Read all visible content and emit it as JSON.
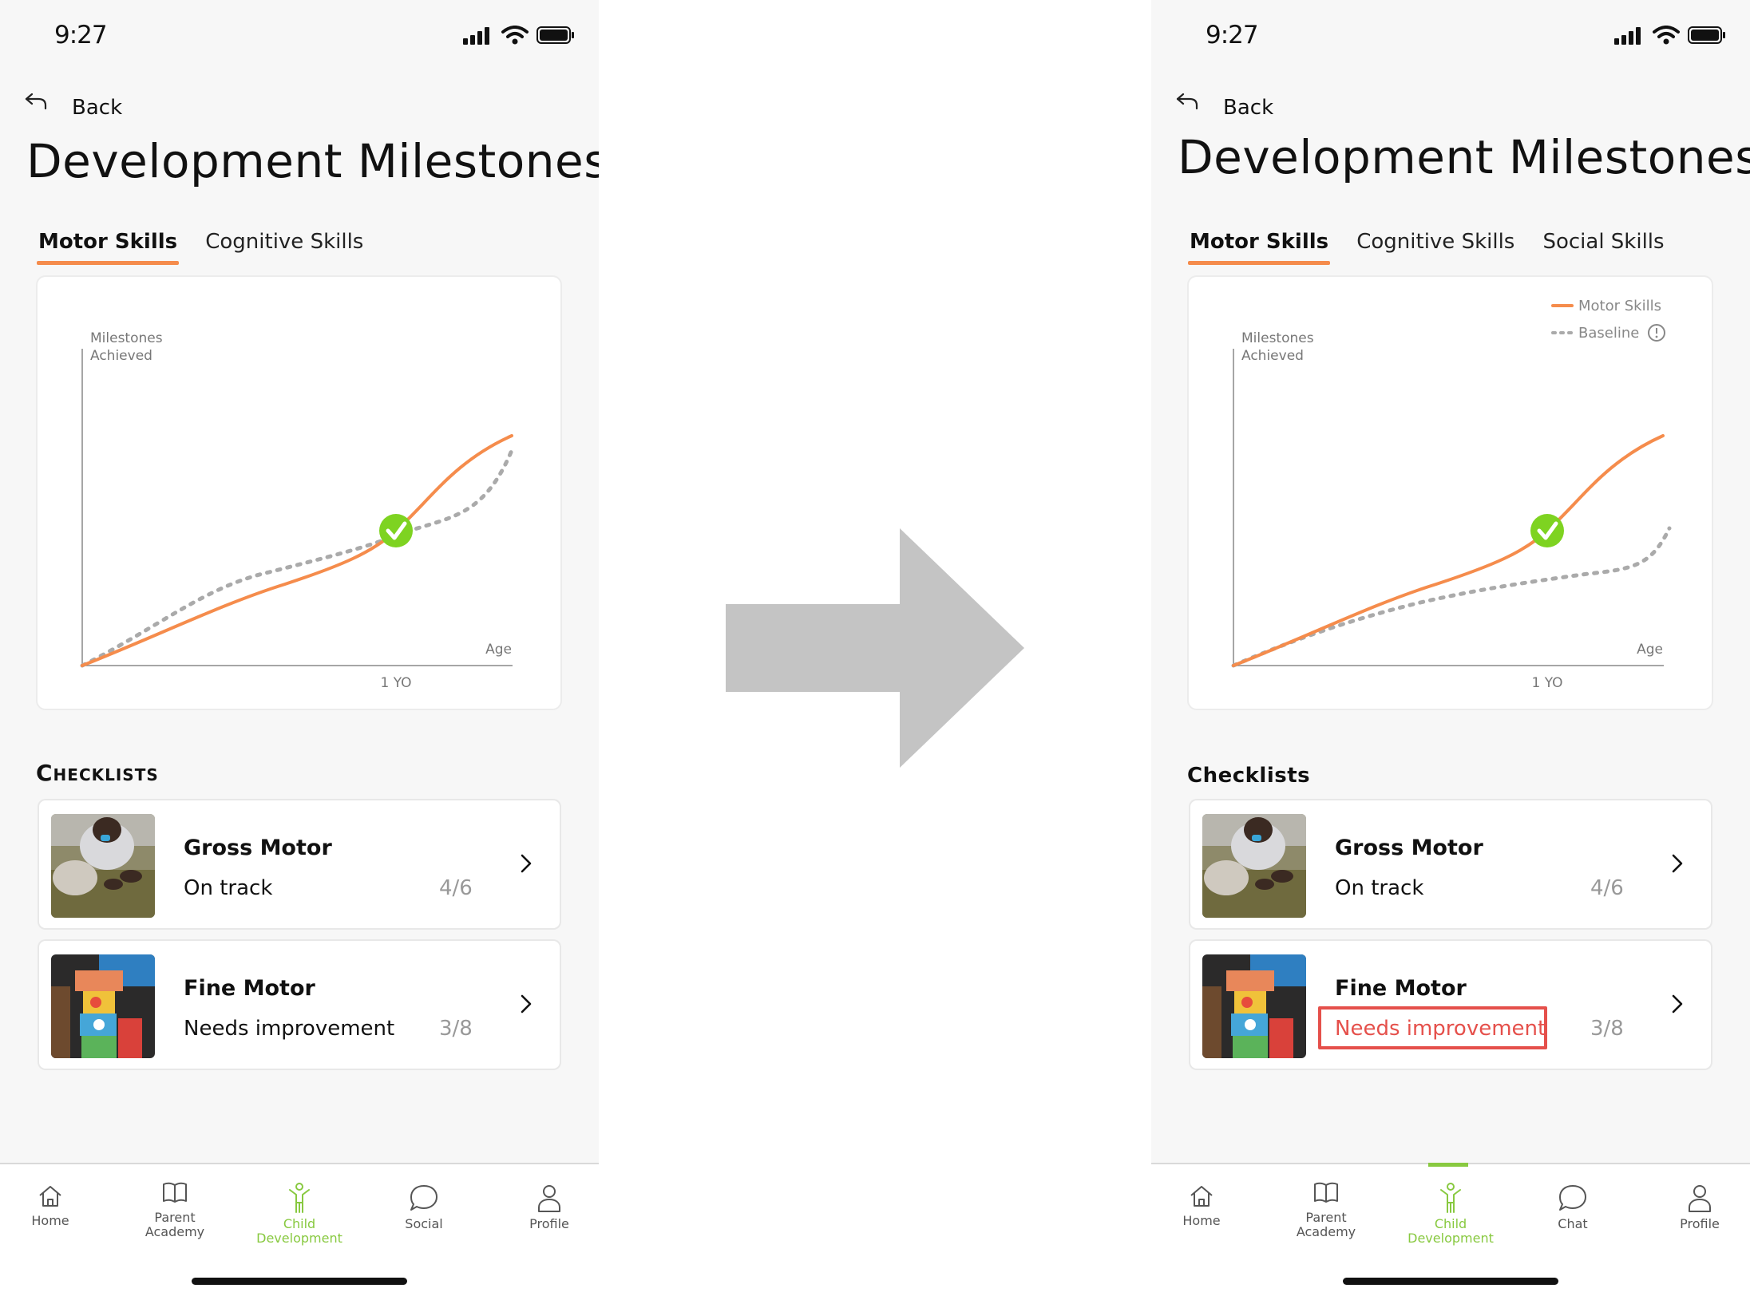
{
  "left": {
    "status_time": "9:27",
    "back_label": "Back",
    "title": "Development Milestones",
    "tabs": [
      {
        "label": "Motor Skills",
        "active": true
      },
      {
        "label": "Cognitive Skills",
        "active": false
      }
    ],
    "chart": {
      "y_label_line1": "Milestones",
      "y_label_line2": "Achieved",
      "x_label": "Age",
      "x_tick": "1 YO",
      "legend": [],
      "milestone_marker": "check-icon"
    },
    "section_title": "Checklists",
    "checklists": [
      {
        "title": "Gross Motor",
        "status": "On track",
        "count": "4/6"
      },
      {
        "title": "Fine Motor",
        "status": "Needs improvement",
        "count": "3/8"
      }
    ],
    "nav": [
      {
        "label": "Home",
        "icon": "home-icon",
        "active": false
      },
      {
        "label": "Parent Academy",
        "line1": "Parent",
        "line2": "Academy",
        "icon": "book-icon",
        "active": false
      },
      {
        "label": "Child Development",
        "line1": "Child",
        "line2": "Development",
        "icon": "child-icon",
        "active": true
      },
      {
        "label": "Social",
        "icon": "chat-bubble-icon",
        "active": false
      },
      {
        "label": "Profile",
        "icon": "person-icon",
        "active": false
      }
    ]
  },
  "right": {
    "status_time": "9:27",
    "back_label": "Back",
    "title": "Development Milestones",
    "tabs": [
      {
        "label": "Motor Skills",
        "active": true
      },
      {
        "label": "Cognitive Skills",
        "active": false
      },
      {
        "label": "Social Skills",
        "active": false
      }
    ],
    "chart": {
      "y_label_line1": "Milestones",
      "y_label_line2": "Achieved",
      "x_label": "Age",
      "x_tick": "1 YO",
      "legend": [
        {
          "name": "Motor Skills",
          "style": "solid",
          "color": "#f58c4c"
        },
        {
          "name": "Baseline",
          "style": "dotted",
          "color": "#aaaaaa",
          "icon": "info-icon"
        }
      ],
      "milestone_marker": "check-icon"
    },
    "section_title": "Checklists",
    "checklists": [
      {
        "title": "Gross Motor",
        "status": "On track",
        "count": "4/6"
      },
      {
        "title": "Fine Motor",
        "status": "Needs improvement",
        "count": "3/8",
        "highlighted": true
      }
    ],
    "nav": [
      {
        "label": "Home",
        "icon": "home-icon",
        "active": false
      },
      {
        "label": "Parent Academy",
        "line1": "Parent",
        "line2": "Academy",
        "icon": "book-icon",
        "active": false
      },
      {
        "label": "Child Development",
        "line1": "Child",
        "line2": "Development",
        "icon": "child-icon",
        "active": true
      },
      {
        "label": "Chat",
        "icon": "chat-bubble-icon",
        "active": false
      },
      {
        "label": "Profile",
        "icon": "person-icon",
        "active": false
      }
    ]
  },
  "colors": {
    "accent_orange": "#f58c4c",
    "active_green": "#88c940",
    "milestone_green": "#7ed321",
    "alert_red": "#e5504b",
    "baseline_gray": "#aaaaaa",
    "arrow_gray": "#c4c4c4"
  },
  "arrow_icon": "right-arrow-icon"
}
